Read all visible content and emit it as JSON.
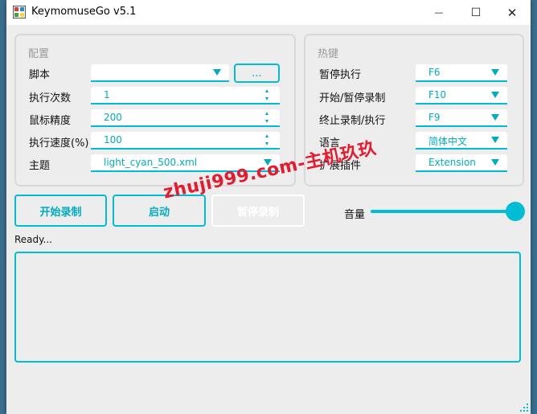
{
  "window": {
    "title": "KeymomuseGo v5.1",
    "minimize_glyph": "—",
    "maximize_glyph": "☐",
    "close_glyph": "✕"
  },
  "config": {
    "group_title": "配置",
    "script_label": "脚本",
    "script_value": "",
    "browse_label": "...",
    "run_times_label": "执行次数",
    "run_times_value": "1",
    "mouse_precision_label": "鼠标精度",
    "mouse_precision_value": "200",
    "run_speed_label": "执行速度(%)",
    "run_speed_value": "100",
    "theme_label": "主题",
    "theme_value": "light_cyan_500.xml"
  },
  "hotkeys": {
    "group_title": "热键",
    "pause_run_label": "暂停执行",
    "pause_run_value": "F6",
    "start_pause_record_label": "开始/暂停录制",
    "start_pause_record_value": "F10",
    "stop_record_run_label": "终止录制/执行",
    "stop_record_run_value": "F9",
    "language_label": "语言",
    "language_value": "简体中文",
    "extension_label": "扩展插件",
    "extension_value": "Extension"
  },
  "actions": {
    "start_record_label": "开始录制",
    "start_label": "启动",
    "pause_record_label": "暂停录制"
  },
  "volume": {
    "label": "音量",
    "level": 1.0
  },
  "status": {
    "text": "Ready..."
  },
  "watermark": {
    "text": "zhuji999.com-主机玖玖"
  },
  "colors": {
    "accent": "#00bcd4",
    "accent_text": "#00acc1",
    "watermark": "#e8192c"
  }
}
